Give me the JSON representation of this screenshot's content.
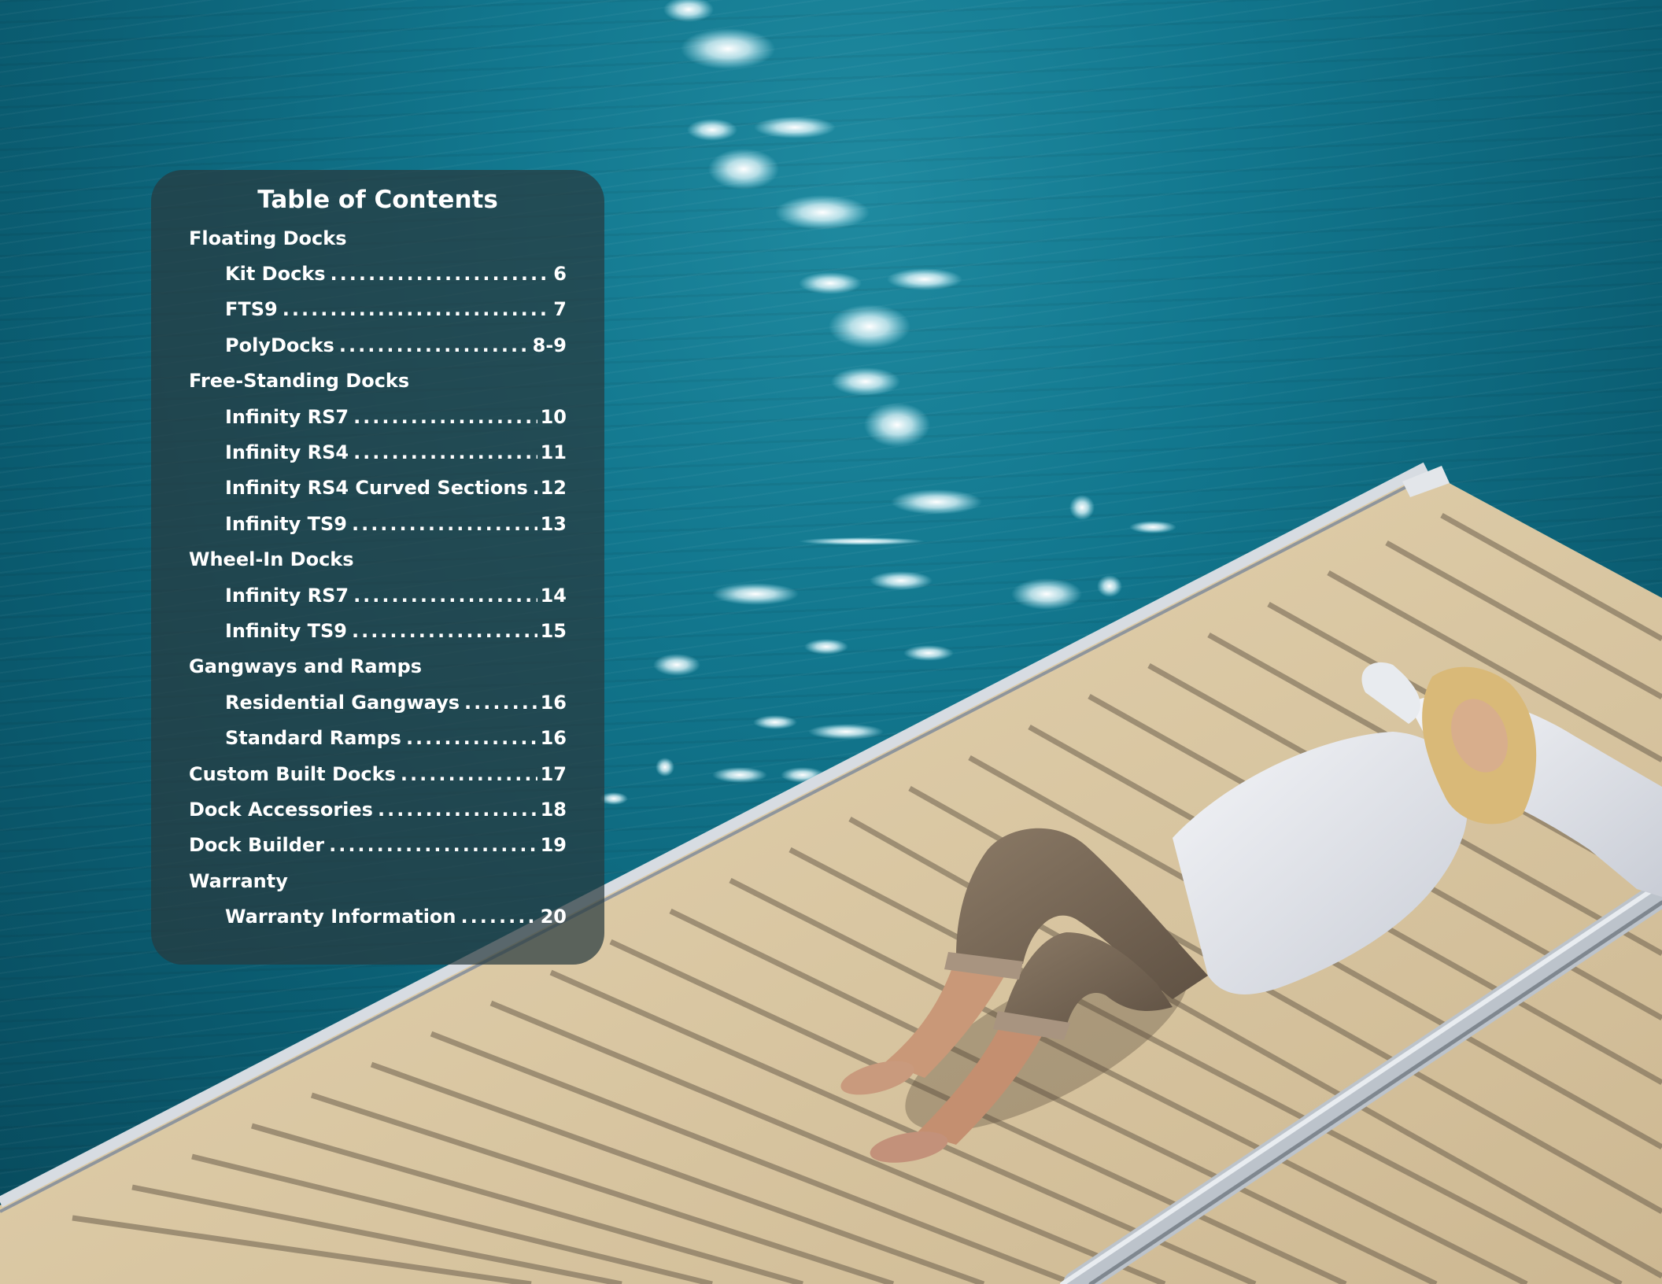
{
  "colors": {
    "water": "#0b5f74",
    "panel": "#283a3e",
    "deck_wood": "#dcc9a2",
    "deck_frame": "#c9ced3",
    "text": "#ffffff"
  },
  "photo": {
    "icon": "woman-relaxing-on-dock-photo"
  },
  "toc": {
    "title": "Table of Contents",
    "entries": [
      {
        "label": "Floating Docks",
        "page": "",
        "level": 1
      },
      {
        "label": "Kit Docks",
        "page": "6",
        "level": 2
      },
      {
        "label": "FTS9",
        "page": "7",
        "level": 2
      },
      {
        "label": "PolyDocks",
        "page": "8-9",
        "level": 2
      },
      {
        "label": "Free-Standing Docks",
        "page": "",
        "level": 1
      },
      {
        "label": "Infinity RS7",
        "page": "10",
        "level": 2
      },
      {
        "label": "Infinity RS4",
        "page": "11",
        "level": 2
      },
      {
        "label": "Infinity RS4 Curved Sections",
        "page": "12",
        "level": 2
      },
      {
        "label": "Infinity TS9",
        "page": "13",
        "level": 2
      },
      {
        "label": "Wheel-In Docks",
        "page": "",
        "level": 1
      },
      {
        "label": "Infinity RS7",
        "page": "14",
        "level": 2
      },
      {
        "label": "Infinity TS9",
        "page": "15",
        "level": 2
      },
      {
        "label": "Gangways and Ramps",
        "page": "",
        "level": 1
      },
      {
        "label": "Residential Gangways",
        "page": "16",
        "level": 2
      },
      {
        "label": "Standard Ramps",
        "page": "16",
        "level": 2
      },
      {
        "label": "Custom Built Docks",
        "page": "17",
        "level": 1
      },
      {
        "label": "Dock Accessories",
        "page": "18",
        "level": 1
      },
      {
        "label": "Dock Builder",
        "page": "19",
        "level": 1
      },
      {
        "label": "Warranty",
        "page": "",
        "level": 1
      },
      {
        "label": "Warranty Information",
        "page": "20",
        "level": 2
      }
    ]
  }
}
